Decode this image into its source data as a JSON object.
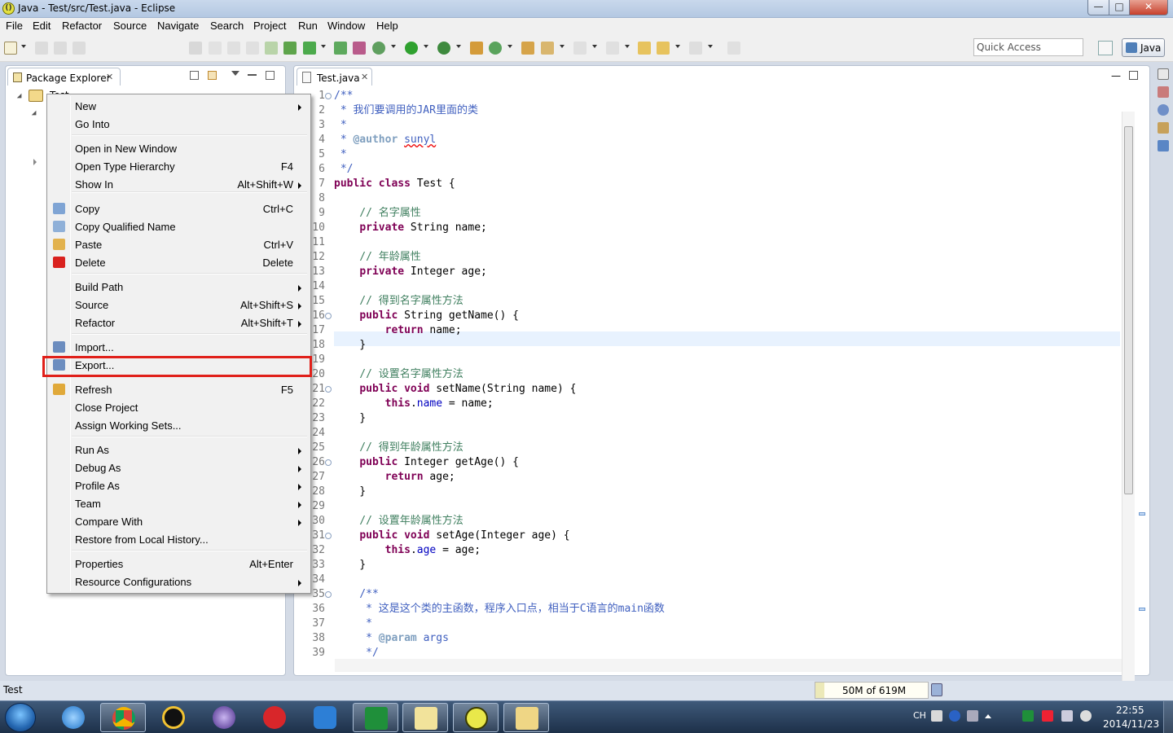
{
  "window": {
    "title": "Java - Test/src/Test.java - Eclipse",
    "app_icon": "eclipse-icon",
    "close_glyph": "✕",
    "min_glyph": "—",
    "max_glyph": "□"
  },
  "menubar": [
    "File",
    "Edit",
    "Refactor",
    "Source",
    "Navigate",
    "Search",
    "Project",
    "Run",
    "Window",
    "Help"
  ],
  "toolbar": {
    "quick_access_placeholder": "Quick Access",
    "perspective": "Java"
  },
  "package_explorer": {
    "tab_label": "Package Explorer",
    "close_glyph": "✕",
    "root_label": "Test"
  },
  "editor": {
    "tab_label": "Test.java",
    "close_glyph": "✕",
    "min_glyph": "—",
    "line_numbers": [
      "1",
      "2",
      "3",
      "4",
      "5",
      "6",
      "7",
      "8",
      "9",
      "10",
      "11",
      "12",
      "13",
      "14",
      "15",
      "16",
      "17",
      "18",
      "19",
      "20",
      "21",
      "22",
      "23",
      "24",
      "25",
      "26",
      "27",
      "28",
      "29",
      "30",
      "31",
      "32",
      "33",
      "34",
      "35",
      "36",
      "37",
      "38",
      "39"
    ],
    "lines": [
      "/**",
      " * 我们要调用的JAR里面的类",
      " *",
      " * @author sunyl",
      " *",
      " */",
      "public class Test {",
      "",
      "    // 名字属性",
      "    private String name;",
      "",
      "    // 年龄属性",
      "    private Integer age;",
      "",
      "    // 得到名字属性方法",
      "    public String getName() {",
      "        return name;",
      "    }",
      "",
      "    // 设置名字属性方法",
      "    public void setName(String name) {",
      "        this.name = name;",
      "    }",
      "",
      "    // 得到年龄属性方法",
      "    public Integer getAge() {",
      "        return age;",
      "    }",
      "",
      "    // 设置年龄属性方法",
      "    public void setAge(Integer age) {",
      "        this.age = age;",
      "    }",
      "",
      "    /**",
      "     * 这是这个类的主函数，程序入口点，相当于C语言的main函数",
      "     *",
      "     * @param args",
      "     */"
    ]
  },
  "context_menu": {
    "items": [
      {
        "label": "New",
        "shortcut": "",
        "submenu": true
      },
      {
        "label": "Go Into",
        "shortcut": "",
        "submenu": false
      },
      {
        "label": "Open in New Window",
        "shortcut": "",
        "submenu": false
      },
      {
        "label": "Open Type Hierarchy",
        "shortcut": "F4",
        "submenu": false
      },
      {
        "label": "Show In",
        "shortcut": "Alt+Shift+W",
        "submenu": true
      },
      {
        "label": "Copy",
        "shortcut": "Ctrl+C",
        "submenu": false,
        "icon": "copy-icon"
      },
      {
        "label": "Copy Qualified Name",
        "shortcut": "",
        "submenu": false,
        "icon": "copy-qualified-name-icon"
      },
      {
        "label": "Paste",
        "shortcut": "Ctrl+V",
        "submenu": false,
        "icon": "paste-icon"
      },
      {
        "label": "Delete",
        "shortcut": "Delete",
        "submenu": false,
        "icon": "delete-icon"
      },
      {
        "label": "Build Path",
        "shortcut": "",
        "submenu": true
      },
      {
        "label": "Source",
        "shortcut": "Alt+Shift+S",
        "submenu": true
      },
      {
        "label": "Refactor",
        "shortcut": "Alt+Shift+T",
        "submenu": true
      },
      {
        "label": "Import...",
        "shortcut": "",
        "submenu": false,
        "icon": "import-icon"
      },
      {
        "label": "Export...",
        "shortcut": "",
        "submenu": false,
        "icon": "export-icon"
      },
      {
        "label": "Refresh",
        "shortcut": "F5",
        "submenu": false,
        "icon": "refresh-icon"
      },
      {
        "label": "Close Project",
        "shortcut": "",
        "submenu": false
      },
      {
        "label": "Assign Working Sets...",
        "shortcut": "",
        "submenu": false
      },
      {
        "label": "Run As",
        "shortcut": "",
        "submenu": true
      },
      {
        "label": "Debug As",
        "shortcut": "",
        "submenu": true
      },
      {
        "label": "Profile As",
        "shortcut": "",
        "submenu": true
      },
      {
        "label": "Team",
        "shortcut": "",
        "submenu": true
      },
      {
        "label": "Compare With",
        "shortcut": "",
        "submenu": true
      },
      {
        "label": "Restore from Local History...",
        "shortcut": "",
        "submenu": false
      },
      {
        "label": "Properties",
        "shortcut": "Alt+Enter",
        "submenu": false
      },
      {
        "label": "Resource Configurations",
        "shortcut": "",
        "submenu": true
      }
    ],
    "highlighted_item": "Export...",
    "highlight_color": "#e0201a"
  },
  "statusbar": {
    "selection": "Test",
    "heap_text": "50M of 619M",
    "heap_used_mb": 50,
    "heap_total_mb": 619
  },
  "taskbar": {
    "apps": [
      "start-icon",
      "internet-explorer-icon",
      "chrome-icon",
      "qq-icon",
      "eclipse-taskbar-icon",
      "app-red-icon",
      "sogou-icon",
      "app-green-icon",
      "datagrid-icon",
      "eclipse-active-icon",
      "folder-icon"
    ],
    "tray_lang": "CH",
    "clock_time": "22:55",
    "clock_date": "2014/11/23"
  },
  "colors": {
    "keyword": "#7f0055",
    "comment": "#3f7f5f",
    "javadoc": "#3f5fbf",
    "field": "#0000c0",
    "current_line": "#e8f2fe"
  }
}
